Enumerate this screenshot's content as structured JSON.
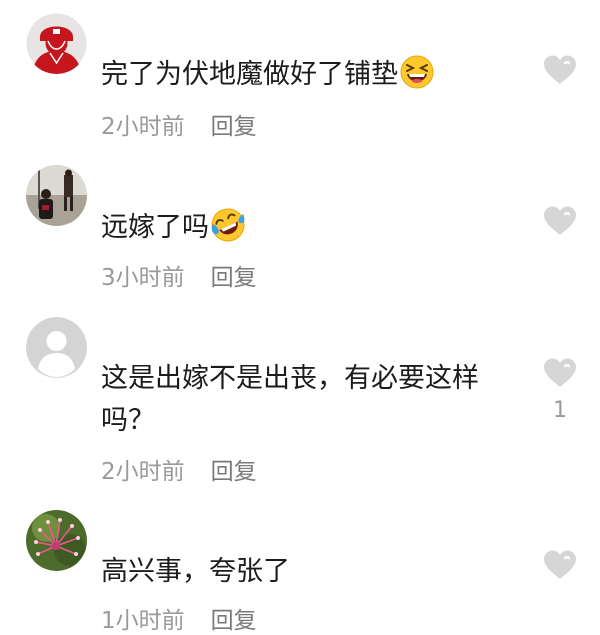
{
  "comments": [
    {
      "username": "",
      "text": "完了为伏地魔做好了铺垫",
      "emoji": "laughing-squint-emoji",
      "time": "2小时前",
      "reply_label": "回复",
      "likes": "",
      "avatar": "red-portrait-avatar"
    },
    {
      "username": "",
      "text": "远嫁了吗",
      "emoji": "rolling-laugh-tears-emoji",
      "time": "3小时前",
      "reply_label": "回复",
      "likes": "",
      "avatar": "street-photo-avatar"
    },
    {
      "username": "",
      "text": "这是出嫁不是出丧，有必要这样吗？",
      "emoji": "",
      "time": "2小时前",
      "reply_label": "回复",
      "likes": "1",
      "avatar": "default-gray-avatar"
    },
    {
      "username": "",
      "text": "高兴事，夸张了",
      "emoji": "",
      "time": "1小时前",
      "reply_label": "回复",
      "likes": "",
      "avatar": "pink-flower-avatar"
    }
  ],
  "colors": {
    "heart": "#d6d6d6",
    "text": "#1c1c1c",
    "meta": "#9a9a9a"
  }
}
